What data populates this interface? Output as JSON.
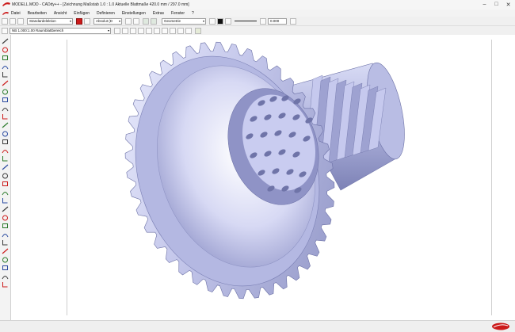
{
  "window": {
    "title": "MODELL.MOD  -  CADdy++ - [Zeichnung   Maßstab 1.0 : 1.0   Aktuelle Blattmaße 420.0 mm / 297.0 mm]",
    "minimize_glyph": "–",
    "maximize_glyph": "□",
    "close_glyph": "✕"
  },
  "menu": {
    "items": [
      "Datei",
      "Bearbeiten",
      "Ansicht",
      "Einfügen",
      "Definieren",
      "Einstellungen",
      "Extras",
      "Fenster",
      "?"
    ]
  },
  "toolbar1": {
    "layer_combo": "Standardelektion",
    "pen_combo": "Absolut (D",
    "linetype_combo": "Geometrie",
    "line_width_value": "0.000"
  },
  "toolbar2": {
    "view_combo": "NB 1.000:1.00 Raumblattbereich"
  },
  "colors": {
    "accent_red": "#cc1a1a",
    "gear_fill": "#c3c6ea",
    "gear_shadow": "#8e93c4",
    "gear_light": "#eef0ff"
  },
  "icons": {
    "left_tools": [
      "select-arrow-icon",
      "pencil-icon",
      "line-icon",
      "polyline-icon",
      "rectangle-icon",
      "trim-icon",
      "circle-icon",
      "arc-icon",
      "ellipse-icon",
      "move-icon",
      "copy-icon",
      "rotate-icon",
      "mirror-icon",
      "offset-icon",
      "text-icon",
      "dimension-icon",
      "hatch-icon",
      "fillet-icon",
      "chamfer-icon",
      "layer-icon",
      "info-icon",
      "measure-icon",
      "group-icon",
      "block-icon",
      "snap-icon",
      "grid-icon",
      "zoom-icon",
      "pan-icon",
      "redraw-icon",
      "curve-icon"
    ]
  }
}
